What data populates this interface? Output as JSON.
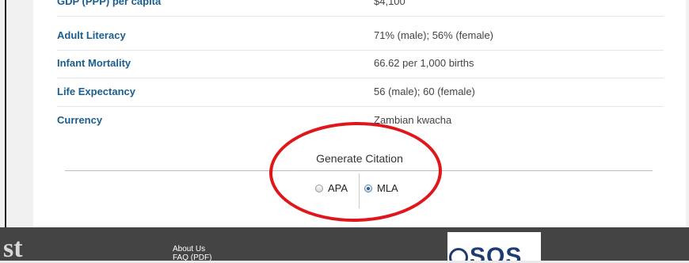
{
  "facts": [
    {
      "label": "GDP (PPP) per capita",
      "value": "$4,100"
    },
    {
      "label": "Adult Literacy",
      "value": "71% (male); 56% (female)"
    },
    {
      "label": "Infant Mortality",
      "value": "66.62 per 1,000 births"
    },
    {
      "label": "Life Expectancy",
      "value": "56 (male); 60 (female)"
    },
    {
      "label": "Currency",
      "value": "Zambian kwacha"
    }
  ],
  "citation": {
    "title": "Generate Citation",
    "options": [
      {
        "label": "APA",
        "selected": false
      },
      {
        "label": "MLA",
        "selected": true
      }
    ]
  },
  "footer": {
    "brand_fragment": "st",
    "links": [
      "About Us",
      "FAQ (PDF)"
    ],
    "logo_text": "SOS"
  },
  "colors": {
    "label": "#1b5e8e",
    "annotation": "#e0161b",
    "footer_bg": "#444444",
    "logo": "#1f3b73"
  }
}
